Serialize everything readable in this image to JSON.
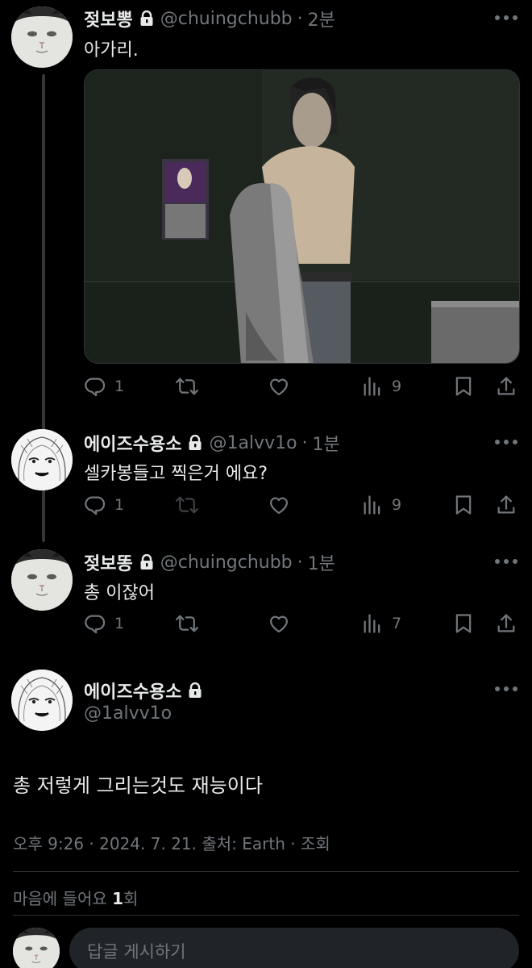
{
  "tweets": [
    {
      "name": "젖보뽕",
      "handle": "@chuingchubb",
      "time": "2분",
      "text": "아가리.",
      "stats": {
        "replies": "1",
        "views": "9"
      }
    },
    {
      "name": "에이즈수용소",
      "handle": "@1alvv1o",
      "time": "1분",
      "text": "셀카봉들고 찍은거 에요?",
      "stats": {
        "replies": "1",
        "views": "9"
      }
    },
    {
      "name": "젖보똥",
      "handle": "@chuingchubb",
      "time": "1분",
      "text": "총 이잖어",
      "stats": {
        "replies": "1",
        "views": "7"
      }
    }
  ],
  "main": {
    "name": "에이즈수용소",
    "handle": "@1alvv1o",
    "text": "총 저렇게 그리는것도 재능이다",
    "meta": "오후 9:26 · 2024. 7. 21. 출처: Earth · 조회",
    "likes_prefix": "마음에 들어요 ",
    "likes_count": "1",
    "likes_suffix": "회"
  },
  "reply_box": {
    "placeholder": "답글 게시하기"
  },
  "icons": [
    "lock-icon",
    "more-icon",
    "reply-icon",
    "retweet-icon",
    "like-icon",
    "views-icon",
    "bookmark-icon",
    "share-icon"
  ],
  "colors": {
    "background": "#000000",
    "text": "#e7e9ea",
    "secondary": "#71767b",
    "divider": "#2f3336",
    "input": "#202327"
  }
}
